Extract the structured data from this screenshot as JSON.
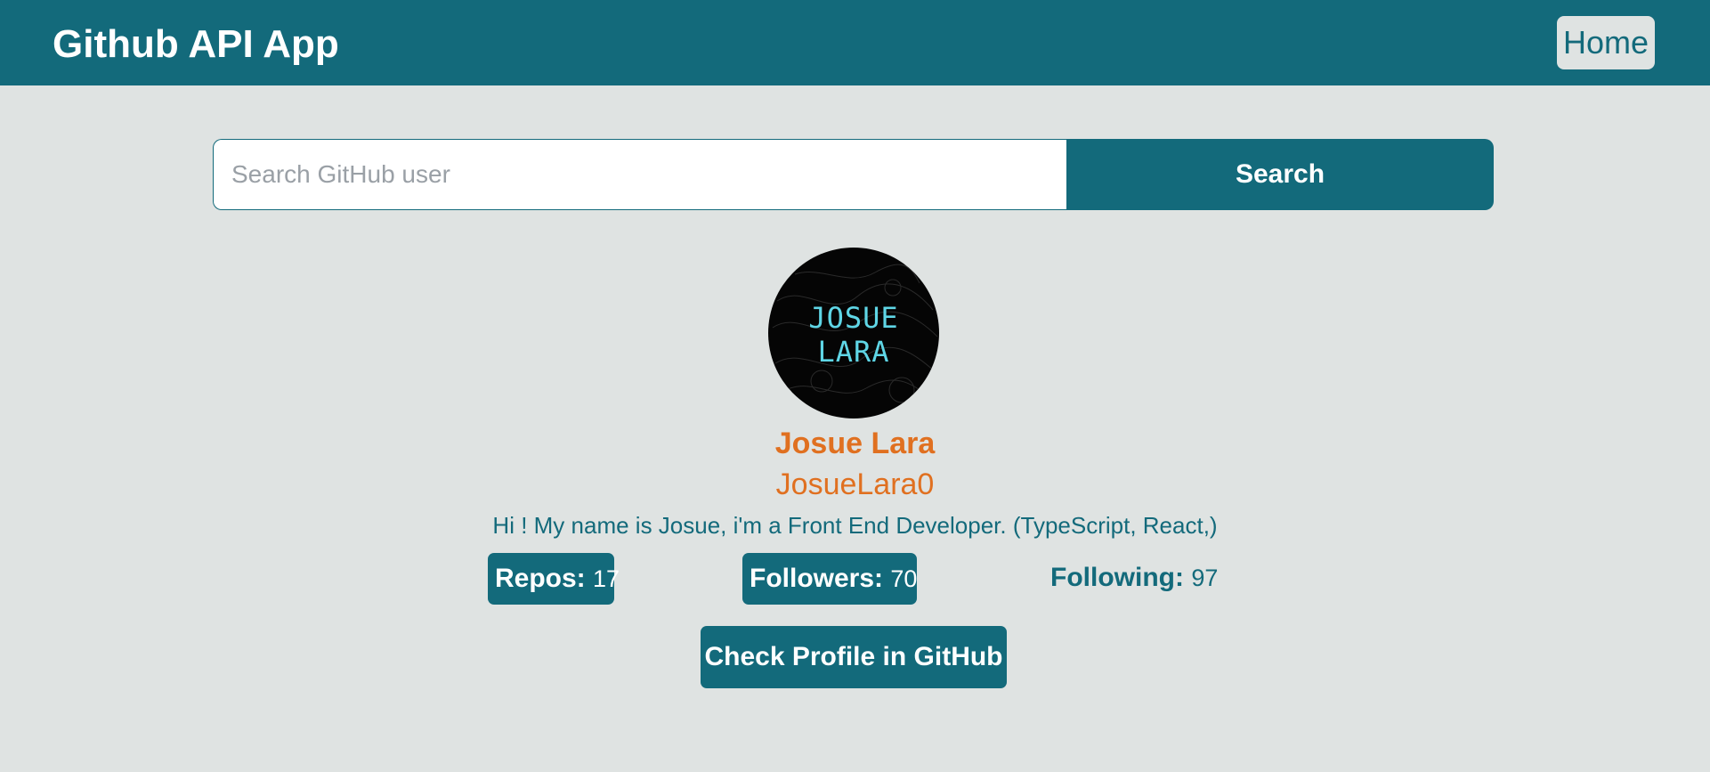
{
  "app": {
    "title": "Github API App"
  },
  "nav": {
    "home_label": "Home"
  },
  "search": {
    "placeholder": "Search GitHub user",
    "value": "",
    "button_label": "Search"
  },
  "profile": {
    "avatar_text_line1": "JOSUE",
    "avatar_text_line2": "LARA",
    "name": "Josue Lara",
    "login": "JosueLara0",
    "bio": "Hi ! My name is Josue, i'm a Front End Developer. (TypeScript, React,)",
    "stats": {
      "repos_label": "Repos:",
      "repos_value": "17",
      "followers_label": "Followers:",
      "followers_value": "70",
      "following_label": "Following:",
      "following_value": "97"
    },
    "profile_button_label": "Check Profile in GitHub"
  },
  "colors": {
    "primary": "#136a7b",
    "background": "#dfe3e2",
    "accent": "#e07020",
    "avatar_text": "#5fd6e6"
  }
}
